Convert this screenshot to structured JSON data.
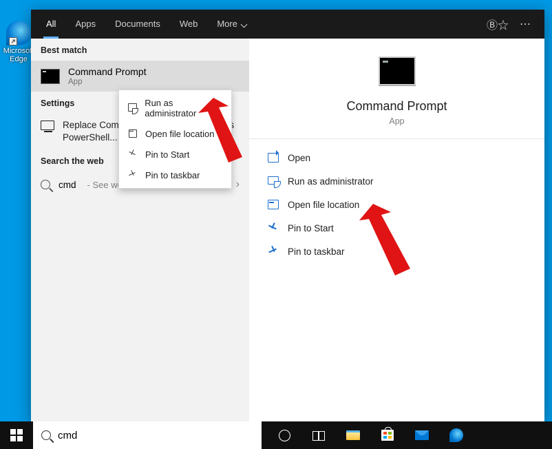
{
  "desktop": {
    "icon_label": "Microsoft Edge"
  },
  "tabs": {
    "all": "All",
    "apps": "Apps",
    "documents": "Documents",
    "web": "Web",
    "more": "More"
  },
  "left": {
    "best_match": "Best match",
    "result_title": "Command Prompt",
    "result_sub": "App",
    "settings_label": "Settings",
    "settings_item": "Replace Command Prompt with Windows PowerShell...",
    "web_label": "Search the web",
    "web_query": "cmd",
    "web_hint": "- See web results"
  },
  "ctx": {
    "run_as": "Run as administrator",
    "open_loc": "Open file location",
    "pin_start": "Pin to Start",
    "pin_taskbar": "Pin to taskbar"
  },
  "preview": {
    "title": "Command Prompt",
    "sub": "App",
    "open": "Open",
    "run_as": "Run as administrator",
    "open_loc": "Open file location",
    "pin_start": "Pin to Start",
    "pin_taskbar": "Pin to taskbar"
  },
  "taskbar": {
    "search_value": "cmd"
  }
}
